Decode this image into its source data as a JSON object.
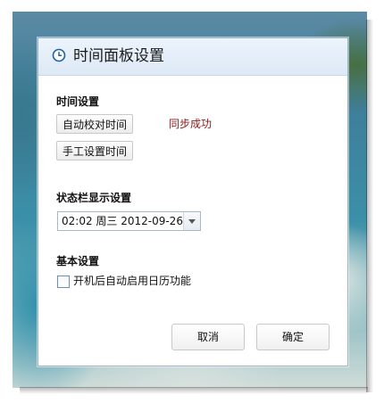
{
  "dialog": {
    "title": "时间面板设置",
    "title_icon": "clock-icon"
  },
  "time_settings": {
    "label": "时间设置",
    "auto_sync_button": "自动校对时间",
    "sync_status": "同步成功",
    "manual_set_button": "手工设置时间"
  },
  "statusbar": {
    "label": "状态栏显示设置",
    "format_selected": "02:02 周三  2012-09-26"
  },
  "basic": {
    "label": "基本设置",
    "launch_calendar_checkbox": {
      "label": "开机后自动启用日历功能",
      "checked": false
    }
  },
  "footer": {
    "cancel_label": "取消",
    "ok_label": "确定"
  },
  "colors": {
    "sync_status": "#8b1a1a",
    "titlebar": "#e4eef9",
    "dialog_border": "#9fb3c7"
  }
}
